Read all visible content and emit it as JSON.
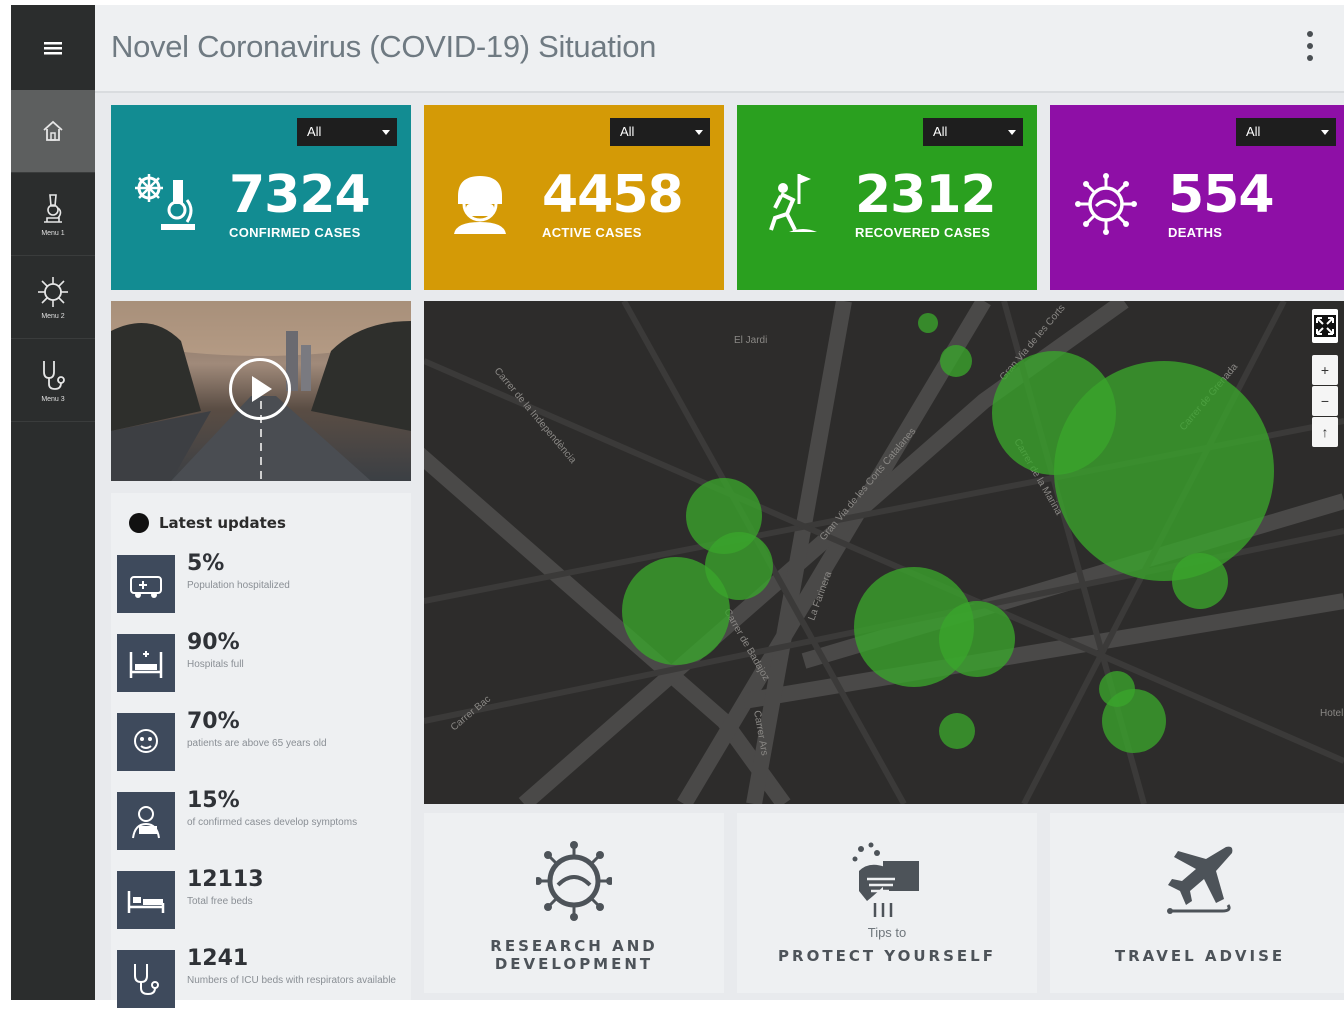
{
  "header": {
    "title": "Novel Coronavirus (COVID-19) Situation"
  },
  "sidebar": {
    "items": [
      {
        "label": "",
        "icon": "home-icon"
      },
      {
        "label": "Menu 1",
        "icon": "microscope-icon"
      },
      {
        "label": "Menu 2",
        "icon": "virus-icon"
      },
      {
        "label": "Menu 3",
        "icon": "stethoscope-icon"
      }
    ]
  },
  "cards": [
    {
      "value": "7324",
      "label": "CONFIRMED CASES",
      "filter": "All",
      "color": "#128c92",
      "icon": "microscope-icon"
    },
    {
      "value": "4458",
      "label": "ACTIVE CASES",
      "filter": "All",
      "color": "#d49a06",
      "icon": "masked-person-icon"
    },
    {
      "value": "2312",
      "label": "RECOVERED CASES",
      "filter": "All",
      "color": "#2aa01f",
      "icon": "climber-flag-icon"
    },
    {
      "value": "554",
      "label": "DEATHS",
      "filter": "All",
      "color": "#8e0fa6",
      "icon": "virus-icon"
    }
  ],
  "updates": {
    "title": "Latest updates",
    "items": [
      {
        "value": "5%",
        "desc": "Population hospitalized",
        "icon": "ambulance-icon"
      },
      {
        "value": "90%",
        "desc": "Hospitals full",
        "icon": "hospital-bed-icon"
      },
      {
        "value": "70%",
        "desc": "patients are above 65 years old",
        "icon": "elderly-face-icon"
      },
      {
        "value": "15%",
        "desc": "of confirmed cases develop symptoms",
        "icon": "sick-person-icon"
      },
      {
        "value": "12113",
        "desc": "Total free beds",
        "icon": "bed-icon"
      },
      {
        "value": "1241",
        "desc": "Numbers of ICU beds with respirators available",
        "icon": "stethoscope-icon"
      }
    ]
  },
  "map": {
    "labels": [
      "El Jardi",
      "Carrer de la Independència",
      "Gran Via de les Corts Catalanes",
      "Gran Via de les Corts",
      "Carrer de la Marina",
      "Carrer de Grenada",
      "Carrer de Badajoz",
      "La Farinera",
      "Carrer Bac",
      "Carrer Ars",
      "Hotel Barc"
    ],
    "controls": {
      "zoom_in": "+",
      "zoom_out": "−",
      "reset": "↑"
    },
    "bubble_color": "#3aa52b"
  },
  "tiles": [
    {
      "small": "",
      "label": "RESEARCH AND DEVELOPMENT",
      "icon": "virus-icon"
    },
    {
      "small": "Tips to",
      "label": "PROTECT YOURSELF",
      "icon": "handwashing-icon"
    },
    {
      "small": "",
      "label": "TRAVEL ADVISE",
      "icon": "airplane-icon"
    }
  ]
}
